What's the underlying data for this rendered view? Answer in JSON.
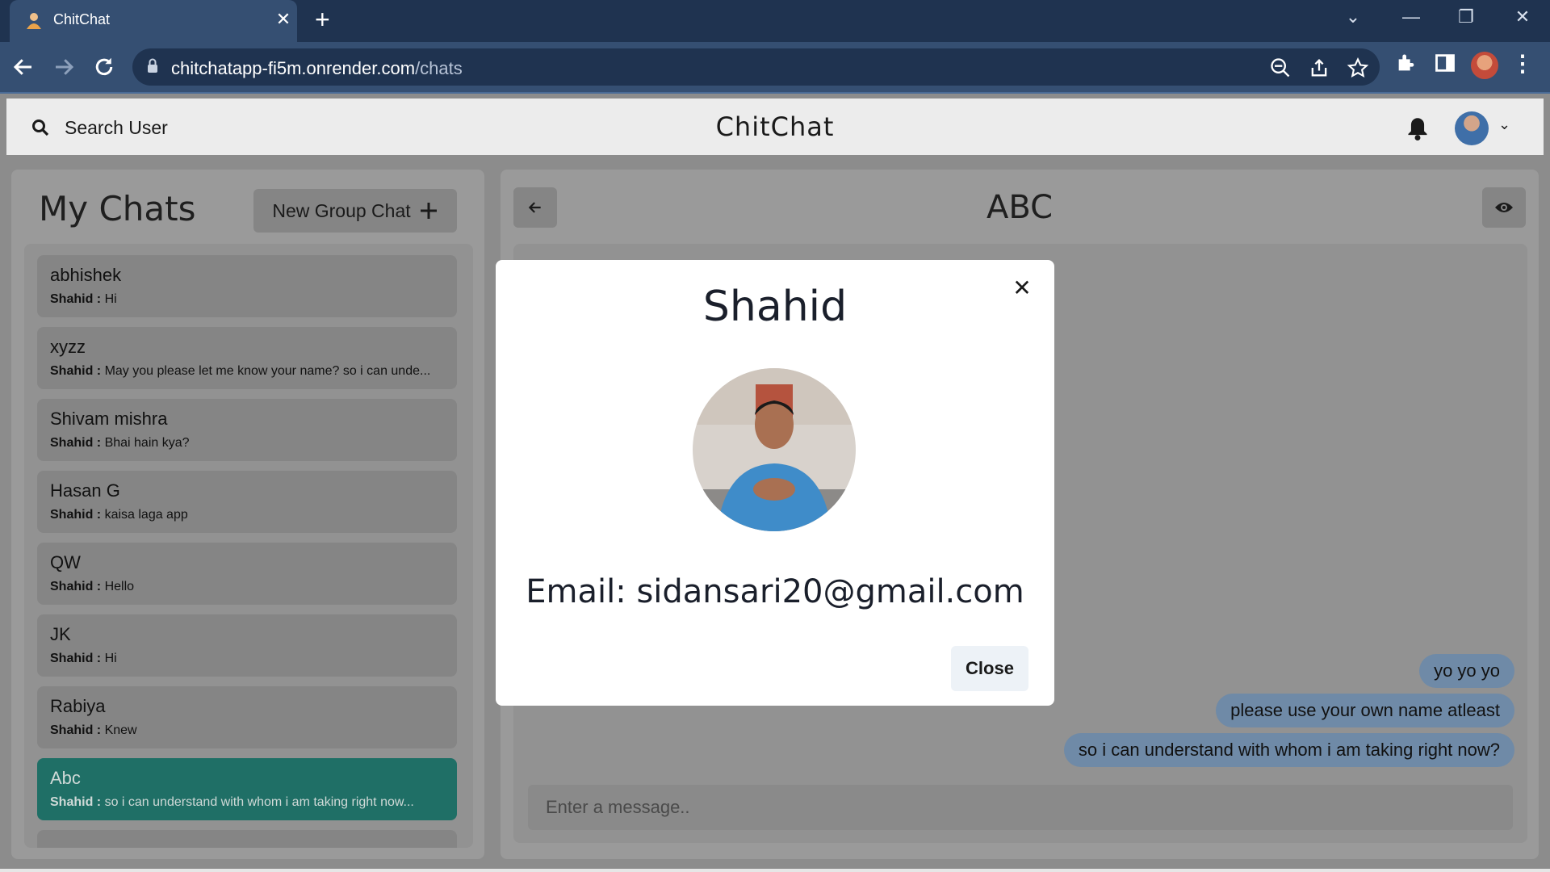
{
  "browser": {
    "tab_title": "ChitChat",
    "new_tab_symbol": "+",
    "tab_close_symbol": "✕",
    "url_host": "chitchatapp-fi5m.onrender.com",
    "url_path": "/chats",
    "window_controls": [
      "⌄",
      "—",
      "❐",
      "✕"
    ]
  },
  "app": {
    "search_label": "Search User",
    "title": "ChitChat",
    "chevron": "⌄"
  },
  "chats_panel": {
    "title": "My Chats",
    "new_group_label": "New Group Chat",
    "new_group_icon": "+",
    "items": [
      {
        "name": "abhishek",
        "sender": "Shahid :",
        "preview": "Hi",
        "selected": false
      },
      {
        "name": "xyzz",
        "sender": "Shahid :",
        "preview": "May you please let me know your name? so i can unde...",
        "selected": false
      },
      {
        "name": "Shivam mishra",
        "sender": "Shahid :",
        "preview": "Bhai hain kya?",
        "selected": false
      },
      {
        "name": "Hasan G",
        "sender": "Shahid :",
        "preview": "kaisa laga app",
        "selected": false
      },
      {
        "name": "QW",
        "sender": "Shahid :",
        "preview": "Hello",
        "selected": false
      },
      {
        "name": "JK",
        "sender": "Shahid :",
        "preview": "Hi",
        "selected": false
      },
      {
        "name": "Rabiya",
        "sender": "Shahid :",
        "preview": "Knew",
        "selected": false
      },
      {
        "name": "Abc",
        "sender": "Shahid :",
        "preview": "so i can understand with whom i am taking right now...",
        "selected": true
      }
    ]
  },
  "chat_panel": {
    "title": "ABC",
    "messages": [
      "yo yo yo",
      "please use your own name atleast",
      "so i can understand with whom i am taking right now?"
    ],
    "input_placeholder": "Enter a message.."
  },
  "modal": {
    "name": "Shahid",
    "email": "Email: sidansari20@gmail.com",
    "close_label": "Close",
    "close_x": "✕"
  },
  "colors": {
    "selected_chat": "#1f6f66",
    "bubble": "#6f8aa7",
    "browser_dark": "#1f3350",
    "browser_bar": "#354f72"
  }
}
